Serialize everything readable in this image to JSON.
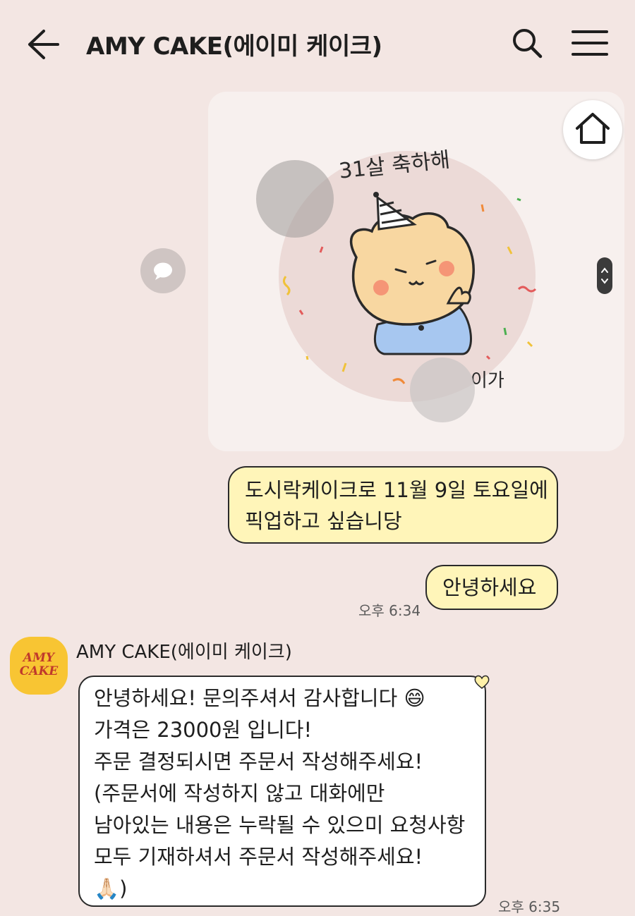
{
  "header": {
    "title": "AMY CAKE(에이미 케이크)"
  },
  "image_message": {
    "cake_text_top": "31살 축하해",
    "cake_text_bottom": "이가"
  },
  "messages": {
    "me_1": [
      "도시락케이크로 11월 9일 토요일에",
      "픽업하고 싶습니당"
    ],
    "me_2": "안녕하세요",
    "me_time": "오후 6:34",
    "sender_name": "AMY CAKE(에이미 케이크)",
    "avatar_text": [
      "AMY",
      "CAKE"
    ],
    "them_lines": [
      "안녕하세요! 문의주셔서 감사합니다 😄",
      "가격은 23000원 입니다!",
      "주문 결정되시면 주문서 작성해주세요!",
      "(주문서에 작성하지 않고 대화에만",
      "남아있는 내용은 누락될 수 있으미 요청사항",
      "모두 기재하셔서 주문서 작성해주세요!",
      "🙏🏻)"
    ],
    "them_time": "오후 6:35"
  },
  "colors": {
    "background": "#f3e6e3",
    "my_bubble": "#fff5b9",
    "their_bubble": "#ffffff",
    "avatar": "#f8c533"
  },
  "icons": [
    "back-arrow-icon",
    "search-icon",
    "menu-icon",
    "home-icon",
    "share-icon",
    "scroll-handle-icon",
    "heart-icon"
  ]
}
